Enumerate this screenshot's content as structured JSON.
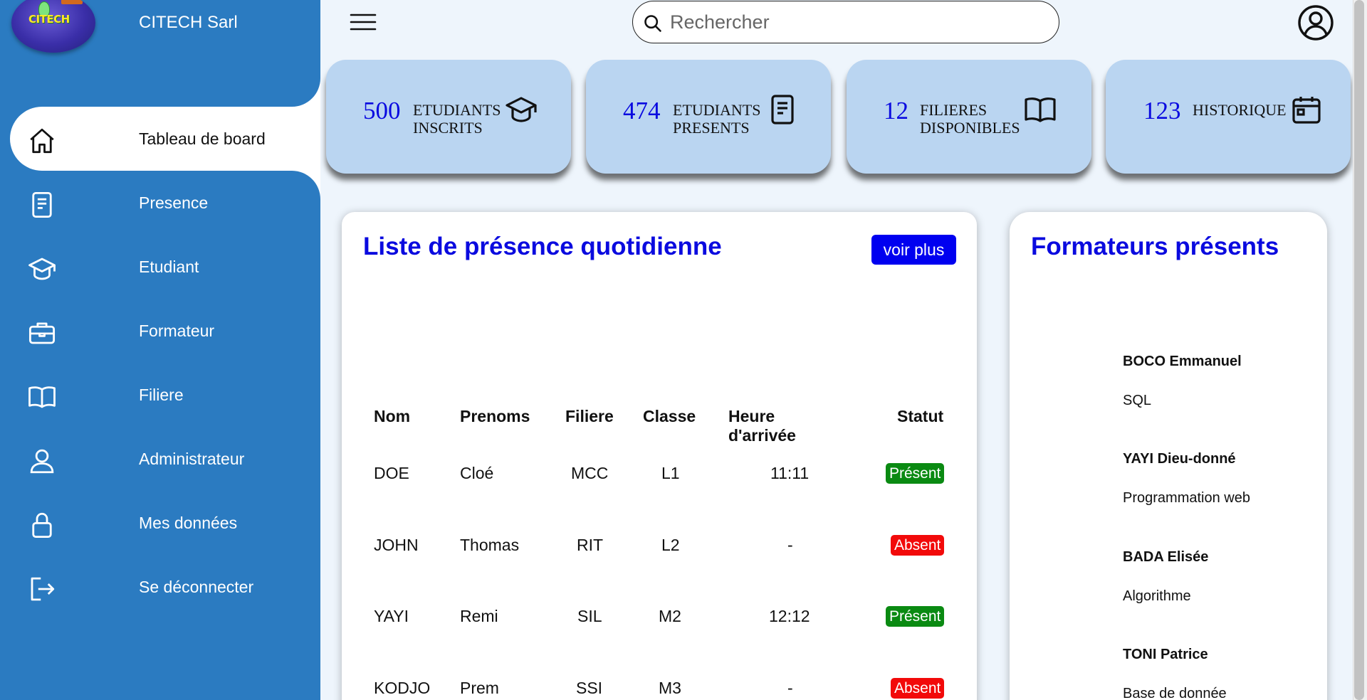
{
  "brand": {
    "name": "CITECH Sarl",
    "logo_text": "CITECH"
  },
  "nav": {
    "items": [
      {
        "label": "Tableau de board",
        "icon": "home-icon",
        "active": true
      },
      {
        "label": "Presence",
        "icon": "document-icon"
      },
      {
        "label": "Etudiant",
        "icon": "graduation-cap-icon"
      },
      {
        "label": "Formateur",
        "icon": "briefcase-icon"
      },
      {
        "label": "Filiere",
        "icon": "book-icon"
      },
      {
        "label": "Administrateur",
        "icon": "user-icon"
      },
      {
        "label": "Mes données",
        "icon": "lock-icon"
      },
      {
        "label": "Se déconnecter",
        "icon": "logout-icon"
      }
    ]
  },
  "topbar": {
    "search_placeholder": "Rechercher",
    "menu_icon": "hamburger-icon",
    "user_icon": "user-circle-icon"
  },
  "stats": [
    {
      "value": "500",
      "label_line1": "ETUDIANTS",
      "label_line2": "INSCRITS",
      "icon": "graduation-cap-icon"
    },
    {
      "value": "474",
      "label_line1": "ETUDIANTS",
      "label_line2": "PRESENTS",
      "icon": "document-icon"
    },
    {
      "value": "12",
      "label_line1": "FILIERES",
      "label_line2": "DISPONIBLES",
      "icon": "book-icon"
    },
    {
      "value": "123",
      "label_line1": "HISTORIQUE",
      "label_line2": "",
      "icon": "calendar-icon"
    }
  ],
  "attendance": {
    "title": "Liste de présence quotidienne",
    "more_button": "voir plus",
    "columns": [
      "Nom",
      "Prenoms",
      "Filiere",
      "Classe",
      "Heure d'arrivée",
      "Statut"
    ],
    "rows": [
      {
        "nom": "DOE",
        "prenoms": "Cloé",
        "filiere": "MCC",
        "classe": "L1",
        "heure": "11:11",
        "statut": "Présent",
        "status_color": "#0a8a12"
      },
      {
        "nom": "JOHN",
        "prenoms": "Thomas",
        "filiere": "RIT",
        "classe": "L2",
        "heure": "-",
        "statut": "Absent",
        "status_color": "#f20a0a"
      },
      {
        "nom": "YAYI",
        "prenoms": "Remi",
        "filiere": "SIL",
        "classe": "M2",
        "heure": "12:12",
        "statut": "Présent",
        "status_color": "#0a8a12"
      },
      {
        "nom": "KODJO",
        "prenoms": "Prem",
        "filiere": "SSI",
        "classe": "M3",
        "heure": "-",
        "statut": "Absent",
        "status_color": "#f20a0a"
      }
    ]
  },
  "trainers": {
    "title": "Formateurs présents",
    "items": [
      {
        "name": "BOCO Emmanuel",
        "subject": "SQL"
      },
      {
        "name": "YAYI Dieu-donné",
        "subject": "Programmation web"
      },
      {
        "name": "BADA Elisée",
        "subject": "Algorithme"
      },
      {
        "name": "TONI Patrice",
        "subject": "Base de donnée"
      }
    ]
  },
  "colors": {
    "sidebar": "#2b7bc1",
    "card": "#bad5f1",
    "accent_blue": "#0a0adf",
    "present": "#0a8a12",
    "absent": "#f20a0a",
    "background": "#eef5fc"
  }
}
